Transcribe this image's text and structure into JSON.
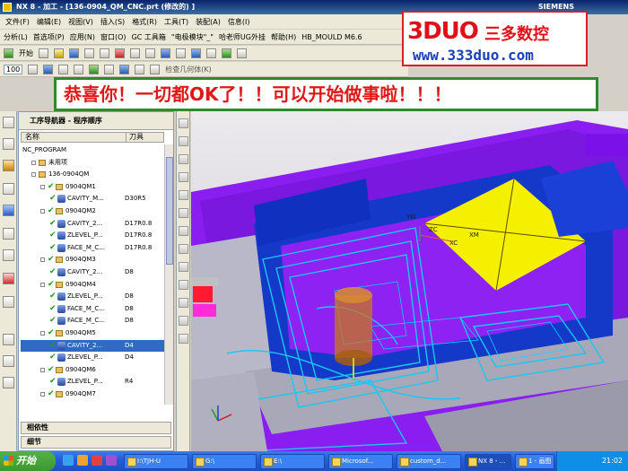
{
  "window": {
    "title": "NX 8 - 加工 - [136-0904_QM_CNC.prt  (修改的) ]",
    "brand": "SIEMENS"
  },
  "menubar": {
    "items": [
      "文件(F)",
      "编辑(E)",
      "视图(V)",
      "插入(S)",
      "格式(R)",
      "工具(T)",
      "装配(A)",
      "信息(I)"
    ]
  },
  "toolbar2": {
    "items": [
      "分析(L)",
      "首选项(P)",
      "应用(N)",
      "窗口(O)",
      "GC 工具箱",
      "\"电极模块\"_\"",
      "哈老师UG外挂",
      "帮助(H)",
      "HB_MOULD M6.6"
    ]
  },
  "toolbar3": {
    "start_label": "开始"
  },
  "toolbar4": {
    "zoom_value": "100",
    "hint": "检查几何体(K)"
  },
  "logo": {
    "big_text": "3DUO",
    "cn_text": "三多数控",
    "url": "www.333duo.com"
  },
  "banner": {
    "text": "恭喜你！一切都OK了！！可以开始做事啦！！！"
  },
  "navigator": {
    "title": "工序导航器 - 程序顺序",
    "col_name": "名称",
    "col_tool": "刀具",
    "rows": [
      {
        "label": "NC_PROGRAM",
        "tool": "",
        "level": 0,
        "kind": "text"
      },
      {
        "label": "未用项",
        "tool": "",
        "level": 1,
        "kind": "folder"
      },
      {
        "label": "136-0904QM",
        "tool": "",
        "level": 1,
        "kind": "program"
      },
      {
        "label": "0904QM1",
        "tool": "",
        "level": 2,
        "kind": "folder"
      },
      {
        "label": "CAVITY_M...",
        "tool": "D30R5",
        "level": 3,
        "kind": "op"
      },
      {
        "label": "0904QM2",
        "tool": "",
        "level": 2,
        "kind": "folder"
      },
      {
        "label": "CAVITY_2...",
        "tool": "D17R0.8",
        "level": 3,
        "kind": "op"
      },
      {
        "label": "ZLEVEL_P...",
        "tool": "D17R0.8",
        "level": 3,
        "kind": "op"
      },
      {
        "label": "FACE_M_C...",
        "tool": "D17R0.8",
        "level": 3,
        "kind": "op"
      },
      {
        "label": "0904QM3",
        "tool": "",
        "level": 2,
        "kind": "folder"
      },
      {
        "label": "CAVITY_2...",
        "tool": "D8",
        "level": 3,
        "kind": "op"
      },
      {
        "label": "0904QM4",
        "tool": "",
        "level": 2,
        "kind": "folder"
      },
      {
        "label": "ZLEVEL_P...",
        "tool": "D8",
        "level": 3,
        "kind": "op"
      },
      {
        "label": "FACE_M_C...",
        "tool": "D8",
        "level": 3,
        "kind": "op"
      },
      {
        "label": "FACE_M_C...",
        "tool": "D8",
        "level": 3,
        "kind": "op"
      },
      {
        "label": "0904QM5",
        "tool": "",
        "level": 2,
        "kind": "folder"
      },
      {
        "label": "CAVITY_2...",
        "tool": "D4",
        "level": 3,
        "kind": "op",
        "selected": true
      },
      {
        "label": "ZLEVEL_P...",
        "tool": "D4",
        "level": 3,
        "kind": "op"
      },
      {
        "label": "0904QM6",
        "tool": "",
        "level": 2,
        "kind": "folder"
      },
      {
        "label": "ZLEVEL_P...",
        "tool": "R4",
        "level": 3,
        "kind": "op"
      },
      {
        "label": "0904QM7",
        "tool": "",
        "level": 2,
        "kind": "folder"
      }
    ],
    "panel_dependencies": "相依性",
    "panel_details": "细节"
  },
  "viewport": {
    "axis_labels": [
      "XC",
      "XM",
      "YM",
      "ZC"
    ]
  },
  "taskbar": {
    "start": "开始",
    "tasks": [
      "I:\\TJH-U",
      "G:\\",
      "E:\\",
      "Microsof...",
      "custom_d...",
      "NX 8 - ...",
      "1 - 画图"
    ],
    "clock": "21:02"
  },
  "colors": {
    "part_purple": "#8a1df0",
    "part_yellow": "#f5f000",
    "toolpath_cyan": "#18c8f0",
    "banner_red": "#e01818",
    "banner_border": "#2d8a2d",
    "logo_red": "#e0101a",
    "logo_blue": "#1a3fb8"
  }
}
